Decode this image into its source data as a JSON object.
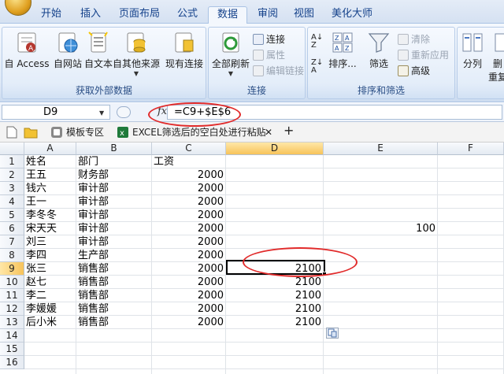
{
  "menu": {
    "tabs": [
      {
        "label": "开始",
        "active": false
      },
      {
        "label": "插入",
        "active": false
      },
      {
        "label": "页面布局",
        "active": false
      },
      {
        "label": "公式",
        "active": false
      },
      {
        "label": "数据",
        "active": true
      },
      {
        "label": "审阅",
        "active": false
      },
      {
        "label": "视图",
        "active": false
      },
      {
        "label": "美化大师",
        "active": false
      }
    ]
  },
  "ribbon": {
    "external": {
      "label": "获取外部数据",
      "access": "自 Access",
      "web": "自网站",
      "text": "自文本",
      "other": "自其他来源",
      "existing": "现有连接"
    },
    "connections": {
      "label": "连接",
      "refresh_all": "全部刷新",
      "connections": "连接",
      "properties": "属性",
      "edit_links": "编辑链接"
    },
    "sort_filter": {
      "label": "排序和筛选",
      "sort": "排序...",
      "filter": "筛选",
      "clear": "清除",
      "reapply": "重新应用",
      "advanced": "高级"
    },
    "data_tools": {
      "split": "分列",
      "remove_top": "删",
      "remove_bottom": "重复"
    }
  },
  "formula_bar": {
    "name_box": "D9",
    "fx": "fx",
    "formula": "=C9+$E$6"
  },
  "doc_tabs": {
    "template_zone": "模板专区",
    "file_title": "EXCEL筛选后的空白处进行粘贴",
    "close": "✕",
    "new_tab": "+"
  },
  "sheet": {
    "columns": [
      "A",
      "B",
      "C",
      "D",
      "E",
      "F"
    ],
    "selected_column": "D",
    "selected_row": 9,
    "rows": [
      {
        "n": 1,
        "A": "姓名",
        "B": "部门",
        "C": "工资",
        "D": "",
        "E": ""
      },
      {
        "n": 2,
        "A": "王五",
        "B": "财务部",
        "C": "2000",
        "D": "",
        "E": ""
      },
      {
        "n": 3,
        "A": "钱六",
        "B": "审计部",
        "C": "2000",
        "D": "",
        "E": ""
      },
      {
        "n": 4,
        "A": "王一",
        "B": "审计部",
        "C": "2000",
        "D": "",
        "E": ""
      },
      {
        "n": 5,
        "A": "李冬冬",
        "B": "审计部",
        "C": "2000",
        "D": "",
        "E": ""
      },
      {
        "n": 6,
        "A": "宋天天",
        "B": "审计部",
        "C": "2000",
        "D": "",
        "E": "100"
      },
      {
        "n": 7,
        "A": "刘三",
        "B": "审计部",
        "C": "2000",
        "D": "",
        "E": ""
      },
      {
        "n": 8,
        "A": "李四",
        "B": "生产部",
        "C": "2000",
        "D": "",
        "E": ""
      },
      {
        "n": 9,
        "A": "张三",
        "B": "销售部",
        "C": "2000",
        "D": "2100",
        "E": ""
      },
      {
        "n": 10,
        "A": "赵七",
        "B": "销售部",
        "C": "2000",
        "D": "2100",
        "E": ""
      },
      {
        "n": 11,
        "A": "李二",
        "B": "销售部",
        "C": "2000",
        "D": "2100",
        "E": ""
      },
      {
        "n": 12,
        "A": "李媛媛",
        "B": "销售部",
        "C": "2000",
        "D": "2100",
        "E": ""
      },
      {
        "n": 13,
        "A": "后小米",
        "B": "销售部",
        "C": "2000",
        "D": "2100",
        "E": ""
      },
      {
        "n": 14,
        "A": "",
        "B": "",
        "C": "",
        "D": "",
        "E": ""
      },
      {
        "n": 15,
        "A": "",
        "B": "",
        "C": "",
        "D": "",
        "E": ""
      },
      {
        "n": 16,
        "A": "",
        "B": "",
        "C": "",
        "D": "",
        "E": ""
      }
    ]
  },
  "colors": {
    "annotation": "#e12a2a",
    "selection_header": "#f7c35a"
  }
}
